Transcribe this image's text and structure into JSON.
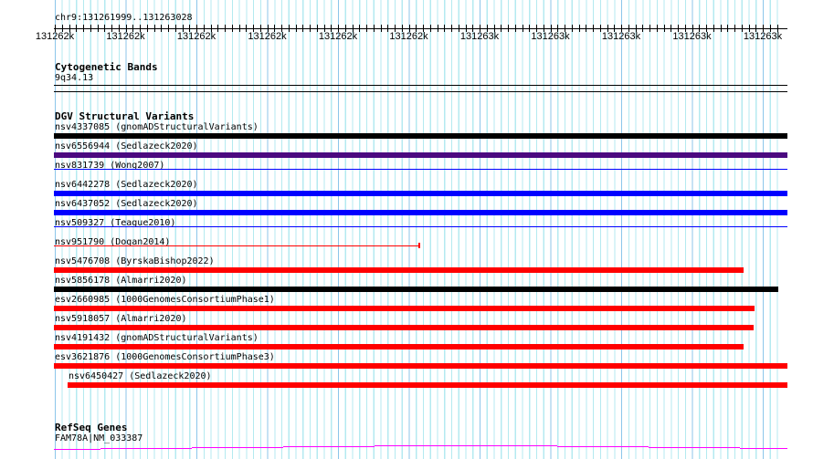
{
  "ruler": {
    "location": "chr9:131261999..131263028",
    "tick_labels": [
      "131262k",
      "131262k",
      "131262k",
      "131262k",
      "131262k",
      "131262k",
      "131263k",
      "131263k",
      "131263k",
      "131263k",
      "131263k"
    ]
  },
  "tracks": {
    "cytoband": {
      "title": "Cytogenetic Bands",
      "band": "9q34.13"
    },
    "dgv": {
      "title": "DGV Structural Variants",
      "variants": [
        {
          "label": "nsv4337085 (gnomADStructuralVariants)",
          "color": "#000000"
        },
        {
          "label": "nsv6556944 (Sedlazeck2020)",
          "color": "#4b0a80"
        },
        {
          "label": "nsv831739 (Wong2007)",
          "color": "#0000ff"
        },
        {
          "label": "nsv6442278 (Sedlazeck2020)",
          "color": "#0000ff"
        },
        {
          "label": "nsv6437052 (Sedlazeck2020)",
          "color": "#0000ff"
        },
        {
          "label": "nsv509327 (Teague2010)",
          "color": "#0000ff"
        },
        {
          "label": "nsv951790 (Dogan2014)",
          "color": "#ff0000"
        },
        {
          "label": "nsv5476708 (ByrskaBishop2022)",
          "color": "#ff0000"
        },
        {
          "label": "nsv5856178 (Almarri2020)",
          "color": "#000000"
        },
        {
          "label": "esv2660985 (1000GenomesConsortiumPhase1)",
          "color": "#ff0000"
        },
        {
          "label": "nsv5918057 (Almarri2020)",
          "color": "#ff0000"
        },
        {
          "label": "nsv4191432 (gnomADStructuralVariants)",
          "color": "#ff0000"
        },
        {
          "label": "esv3621876 (1000GenomesConsortiumPhase3)",
          "color": "#ff0000"
        },
        {
          "label": "nsv6450427 (Sedlazeck2020)",
          "color": "#ff0000"
        }
      ]
    },
    "refseq": {
      "title": "RefSeq Genes",
      "gene": "FAM78A|NM_033387",
      "color": "#ff00ff"
    }
  }
}
